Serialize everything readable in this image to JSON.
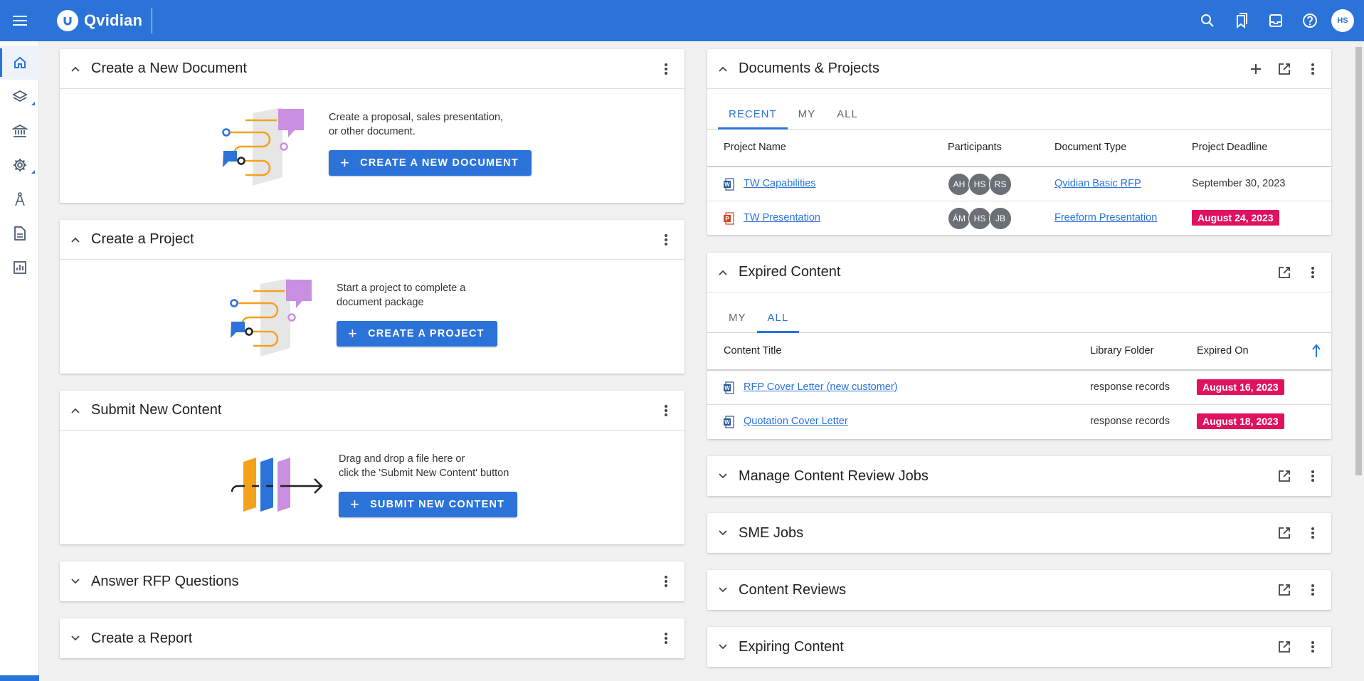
{
  "app": {
    "name": "Qvidian",
    "user_initials": "HS"
  },
  "topbar": {
    "icons": [
      "menu-icon",
      "search-icon",
      "bookmarks-icon",
      "inbox-icon",
      "help-icon"
    ]
  },
  "rail": {
    "items": [
      "home-icon",
      "layers-icon",
      "library-icon",
      "settings-icon",
      "compass-icon",
      "document-icon",
      "reports-icon"
    ]
  },
  "create_document": {
    "title": "Create a New Document",
    "text_line1": "Create a proposal, sales presentation,",
    "text_line2": "or other document.",
    "button": "CREATE A NEW DOCUMENT"
  },
  "create_project": {
    "title": "Create a Project",
    "text_line1": "Start a project to complete a",
    "text_line2": "document package",
    "button": "CREATE A PROJECT"
  },
  "submit_content": {
    "title": "Submit New Content",
    "text_line1": "Drag and drop a file here or",
    "text_line2": "click the 'Submit New Content' button",
    "button": "SUBMIT NEW CONTENT"
  },
  "answer_rfp": {
    "title": "Answer RFP Questions"
  },
  "create_report": {
    "title": "Create a Report"
  },
  "documents_projects": {
    "title": "Documents & Projects",
    "tabs": [
      "RECENT",
      "MY",
      "ALL"
    ],
    "active_tab": "RECENT",
    "columns": [
      "Project Name",
      "Participants",
      "Document Type",
      "Project Deadline"
    ],
    "rows": [
      {
        "name": "TW Capabilities",
        "file_type": "word",
        "participants": [
          "AH",
          "HS",
          "RS"
        ],
        "doc_type": "Qvidian Basic RFP",
        "deadline": "September 30, 2023",
        "overdue": false
      },
      {
        "name": "TW Presentation",
        "file_type": "powerpoint",
        "participants": [
          "ÁM",
          "HS",
          "JB"
        ],
        "doc_type": "Freeform Presentation",
        "deadline": "August 24, 2023",
        "overdue": true
      }
    ]
  },
  "expired_content": {
    "title": "Expired Content",
    "tabs": [
      "MY",
      "ALL"
    ],
    "active_tab": "ALL",
    "columns": [
      "Content Title",
      "Library Folder",
      "Expired On"
    ],
    "rows": [
      {
        "title": "RFP Cover Letter (new customer)",
        "folder": "response records",
        "expired": "August 16, 2023"
      },
      {
        "title": "Quotation Cover Letter",
        "folder": "response records",
        "expired": "August 18, 2023"
      }
    ]
  },
  "review_jobs": {
    "title": "Manage Content Review Jobs"
  },
  "sme_jobs": {
    "title": "SME Jobs"
  },
  "content_reviews": {
    "title": "Content Reviews"
  },
  "expiring_content": {
    "title": "Expiring Content"
  },
  "colors": {
    "brand": "#2b73d9",
    "overdue": "#e0115f",
    "illus_orange": "#f5a21b",
    "illus_purple": "#c98fe0"
  }
}
